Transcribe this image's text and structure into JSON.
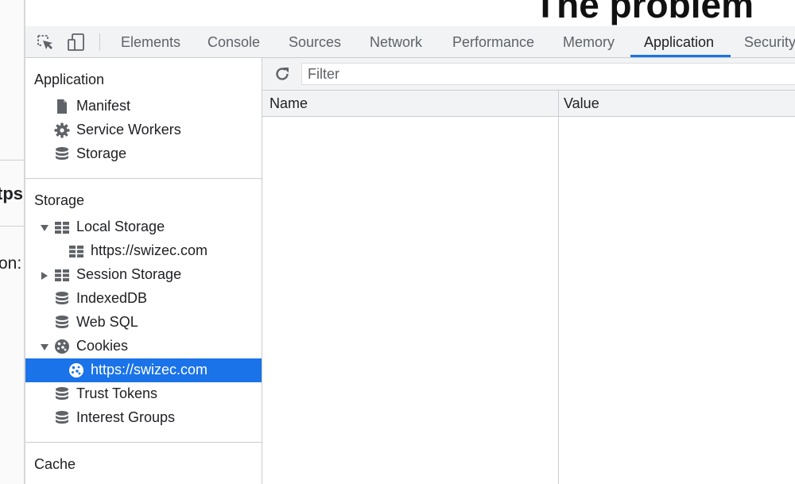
{
  "page": {
    "heading": "The problem",
    "left_fragments": [
      "tps",
      "on:"
    ]
  },
  "toolbar": {
    "inspect_icon": "inspect-element-icon",
    "device_icon": "device-toolbar-icon",
    "tabs": [
      "Elements",
      "Console",
      "Sources",
      "Network",
      "Performance",
      "Memory",
      "Application",
      "Security"
    ],
    "active_tab": "Application",
    "accent_color": "#1a73e8"
  },
  "sidebar": {
    "application": {
      "title": "Application",
      "items": [
        {
          "label": "Manifest",
          "icon": "document-icon"
        },
        {
          "label": "Service Workers",
          "icon": "gear-icon"
        },
        {
          "label": "Storage",
          "icon": "database-icon"
        }
      ]
    },
    "storage": {
      "title": "Storage",
      "items": [
        {
          "label": "Local Storage",
          "icon": "table-icon",
          "expanded": true
        },
        {
          "label": "https://swizec.com",
          "icon": "table-icon"
        },
        {
          "label": "Session Storage",
          "icon": "table-icon",
          "expanded": false
        },
        {
          "label": "IndexedDB",
          "icon": "database-icon"
        },
        {
          "label": "Web SQL",
          "icon": "database-icon"
        },
        {
          "label": "Cookies",
          "icon": "cookie-icon",
          "expanded": true
        },
        {
          "label": "https://swizec.com",
          "icon": "cookie-icon",
          "selected": true
        },
        {
          "label": "Trust Tokens",
          "icon": "database-icon"
        },
        {
          "label": "Interest Groups",
          "icon": "database-icon"
        }
      ]
    },
    "cache": {
      "title": "Cache"
    }
  },
  "main": {
    "filter": {
      "placeholder": "Filter",
      "value": ""
    },
    "columns": [
      "Name",
      "Value"
    ]
  }
}
